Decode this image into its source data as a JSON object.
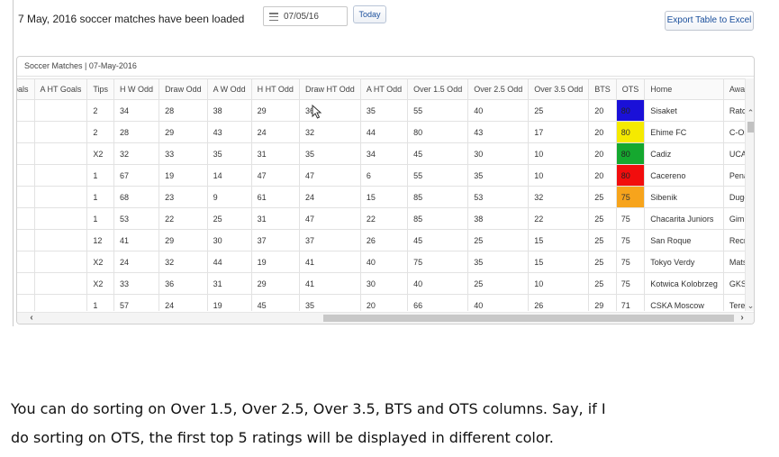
{
  "header": {
    "status_text": "7 May, 2016 soccer matches have been loaded",
    "date_value": "07/05/16",
    "today_label": "Today",
    "export_label": "Export Table to Excel"
  },
  "panel": {
    "title": "Soccer Matches | 07-May-2016"
  },
  "table": {
    "columns": [
      "Goals",
      "A HT Goals",
      "Tips",
      "H W Odd",
      "Draw Odd",
      "A W Odd",
      "H HT Odd",
      "Draw HT Odd",
      "A HT Odd",
      "Over 1.5 Odd",
      "Over 2.5 Odd",
      "Over 3.5 Odd",
      "BTS",
      "OTS",
      "Home",
      "Away"
    ],
    "rows": [
      [
        "",
        "",
        "2",
        "34",
        "28",
        "38",
        "29",
        "36",
        "35",
        "55",
        "40",
        "25",
        "20",
        "80",
        "Sisaket",
        "Ratchaburi"
      ],
      [
        "",
        "",
        "2",
        "28",
        "29",
        "43",
        "24",
        "32",
        "44",
        "80",
        "43",
        "17",
        "20",
        "80",
        "Ehime FC",
        "C-Osaka"
      ],
      [
        "",
        "",
        "X2",
        "32",
        "33",
        "35",
        "31",
        "35",
        "34",
        "45",
        "30",
        "10",
        "20",
        "80",
        "Cadiz",
        "UCAM Murcia"
      ],
      [
        "",
        "",
        "1",
        "67",
        "19",
        "14",
        "47",
        "47",
        "6",
        "55",
        "35",
        "10",
        "20",
        "80",
        "Cacereno",
        "Pena Sport"
      ],
      [
        "",
        "",
        "1",
        "68",
        "23",
        "9",
        "61",
        "24",
        "15",
        "85",
        "53",
        "32",
        "25",
        "75",
        "Sibenik",
        "Dugopolje"
      ],
      [
        "",
        "",
        "1",
        "53",
        "22",
        "25",
        "31",
        "47",
        "22",
        "85",
        "38",
        "22",
        "25",
        "75",
        "Chacarita Juniors",
        "Gimnasia Jujuy"
      ],
      [
        "",
        "",
        "12",
        "41",
        "29",
        "30",
        "37",
        "37",
        "26",
        "45",
        "25",
        "15",
        "25",
        "75",
        "San Roque",
        "Recreativo Huelva"
      ],
      [
        "",
        "",
        "X2",
        "24",
        "32",
        "44",
        "19",
        "41",
        "40",
        "75",
        "35",
        "15",
        "25",
        "75",
        "Tokyo Verdy",
        "Matsumoto Yamaga"
      ],
      [
        "",
        "",
        "X2",
        "33",
        "36",
        "31",
        "29",
        "41",
        "30",
        "40",
        "25",
        "10",
        "25",
        "75",
        "Kotwica Kolobrzeg",
        "GKS Tychy"
      ],
      [
        "",
        "",
        "1",
        "57",
        "24",
        "19",
        "45",
        "35",
        "20",
        "66",
        "40",
        "26",
        "29",
        "71",
        "CSKA Moscow",
        "Terek Grozni"
      ]
    ],
    "ots_highlight_colors": [
      "#1a10d8",
      "#f5ea00",
      "#15a82f",
      "#f20d0d",
      "#f7a41c",
      "",
      "",
      "",
      "",
      ""
    ]
  },
  "caption": {
    "line1": "You can do sorting on Over 1.5, Over 2.5, Over 3.5, BTS and OTS columns. Say, if I",
    "line2": "do sorting on OTS, the first top 5 ratings will be displayed in different color."
  }
}
